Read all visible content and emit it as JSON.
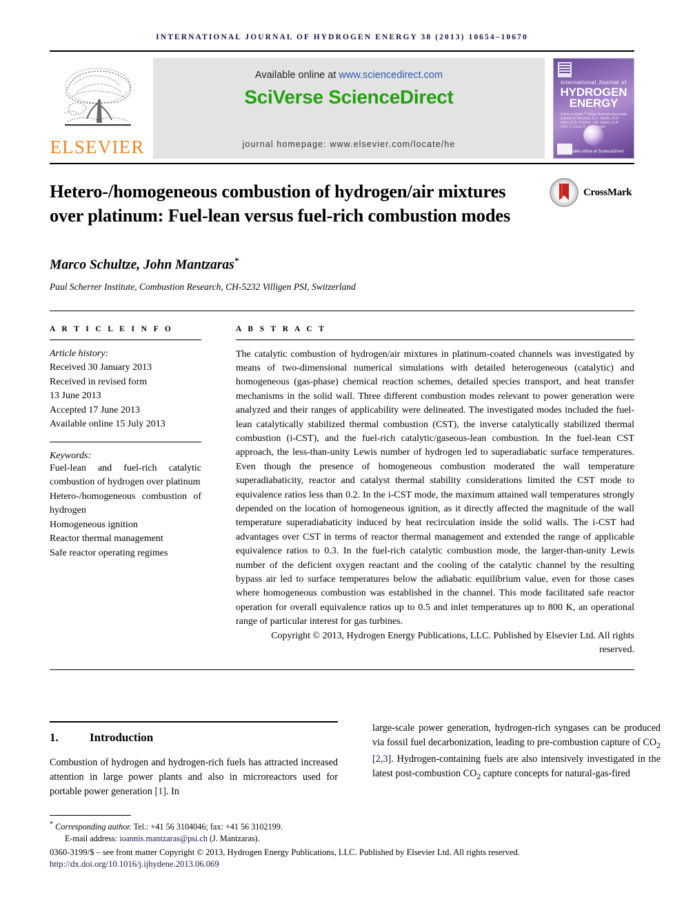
{
  "running_head": "International Journal of Hydrogen Energy 38 (2013) 10654–10670",
  "masthead": {
    "publisher_name": "ELSEVIER",
    "available_prefix": "Available online at ",
    "available_url": "www.sciencedirect.com",
    "platform": "SciVerse ScienceDirect",
    "homepage": "journal homepage: www.elsevier.com/locate/he",
    "cover": {
      "line1": "International Journal of",
      "line2": "HYDROGEN",
      "line3": "ENERGY",
      "editors": "Editor-in-Chief:  T. Nejat Veziroglu     Associate Editors:  A. Bocarsly, E.C. Okafor, M.R. Islam, D.G. Poulton, J.M. Ogden, G.A. Olah, F. Lund, D. Venkatesan",
      "sciencedirect": "Available online at ScienceDirect"
    },
    "colors": {
      "elsevier_orange": "#ec8425",
      "sciverse_green": "#23a010",
      "link_blue": "#2b56b0",
      "cover_purple": "#8e6cb8"
    }
  },
  "article": {
    "title": "Hetero-/homogeneous combustion of hydrogen/air mixtures over platinum: Fuel-lean versus fuel-rich combustion modes",
    "authors": "Marco Schultze, John Mantzaras",
    "corresponding_marker": "*",
    "affiliation": "Paul Scherrer Institute, Combustion Research, CH-5232 Villigen PSI, Switzerland",
    "crossmark_label": "CrossMark"
  },
  "info": {
    "heading": "A R T I C L E   I N F O",
    "history_label": "Article history:",
    "history": [
      "Received 30 January 2013",
      "Received in revised form",
      "13 June 2013",
      "Accepted 17 June 2013",
      "Available online 15 July 2013"
    ],
    "keywords_label": "Keywords:",
    "keywords": [
      "Fuel-lean and fuel-rich catalytic combustion of hydrogen over platinum",
      "Hetero-/homogeneous combustion of hydrogen",
      "Homogeneous ignition",
      "Reactor thermal management",
      "Safe reactor operating regimes"
    ]
  },
  "abstract": {
    "heading": "A B S T R A C T",
    "text": "The catalytic combustion of hydrogen/air mixtures in platinum-coated channels was investigated by means of two-dimensional numerical simulations with detailed heterogeneous (catalytic) and homogeneous (gas-phase) chemical reaction schemes, detailed species transport, and heat transfer mechanisms in the solid wall. Three different combustion modes relevant to power generation were analyzed and their ranges of applicability were delineated. The investigated modes included the fuel-lean catalytically stabilized thermal combustion (CST), the inverse catalytically stabilized thermal combustion (i-CST), and the fuel-rich catalytic/gaseous-lean combustion. In the fuel-lean CST approach, the less-than-unity Lewis number of hydrogen led to superadiabatic surface temperatures. Even though the presence of homogeneous combustion moderated the wall temperature superadiabaticity, reactor and catalyst thermal stability considerations limited the CST mode to equivalence ratios less than 0.2. In the i-CST mode, the maximum attained wall temperatures strongly depended on the location of homogeneous ignition, as it directly affected the magnitude of the wall temperature superadiabaticity induced by heat recirculation inside the solid walls. The i-CST had advantages over CST in terms of reactor thermal management and extended the range of applicable equivalence ratios to 0.3. In the fuel-rich catalytic combustion mode, the larger-than-unity Lewis number of the deficient oxygen reactant and the cooling of the catalytic channel by the resulting bypass air led to surface temperatures below the adiabatic equilibrium value, even for those cases where homogeneous combustion was established in the channel. This mode facilitated safe reactor operation for overall equivalence ratios up to 0.5 and inlet temperatures up to 800 K, an operational range of particular interest for gas turbines.",
    "copyright": "Copyright © 2013, Hydrogen Energy Publications, LLC. Published by Elsevier Ltd. All rights reserved."
  },
  "body": {
    "section_number": "1.",
    "section_title": "Introduction",
    "left_paragraph_part1": "Combustion of hydrogen and hydrogen-rich fuels has attracted increased attention in large power plants and also in microreactors used for portable power generation ",
    "left_citation": "[1]",
    "left_paragraph_part2": ". In",
    "right_paragraph_part1": "large-scale power generation, hydrogen-rich syngases can be produced via fossil fuel decarbonization, leading to pre-combustion capture of CO",
    "right_sub1": "2",
    "right_paragraph_part2": " ",
    "right_citation": "[2,3]",
    "right_paragraph_part3": ". Hydrogen-containing fuels are also intensively investigated in the latest post-combustion CO",
    "right_sub2": "2",
    "right_paragraph_part4": " capture concepts for natural-gas-fired"
  },
  "footnotes": {
    "corresponding_marker": "*",
    "corresponding_label": "Corresponding author.",
    "corresponding_contact": " Tel.: +41 56 3104046; fax: +41 56 3102199.",
    "email_label": "E-mail address: ",
    "email_address": "ioannis.mantzaras@psi.ch",
    "email_suffix": " (J. Mantzaras).",
    "issn_line": "0360-3199/$ – see front matter Copyright © 2013, Hydrogen Energy Publications, LLC. Published by Elsevier Ltd. All rights reserved.",
    "doi": "http://dx.doi.org/10.1016/j.ijhydene.2013.06.069"
  }
}
